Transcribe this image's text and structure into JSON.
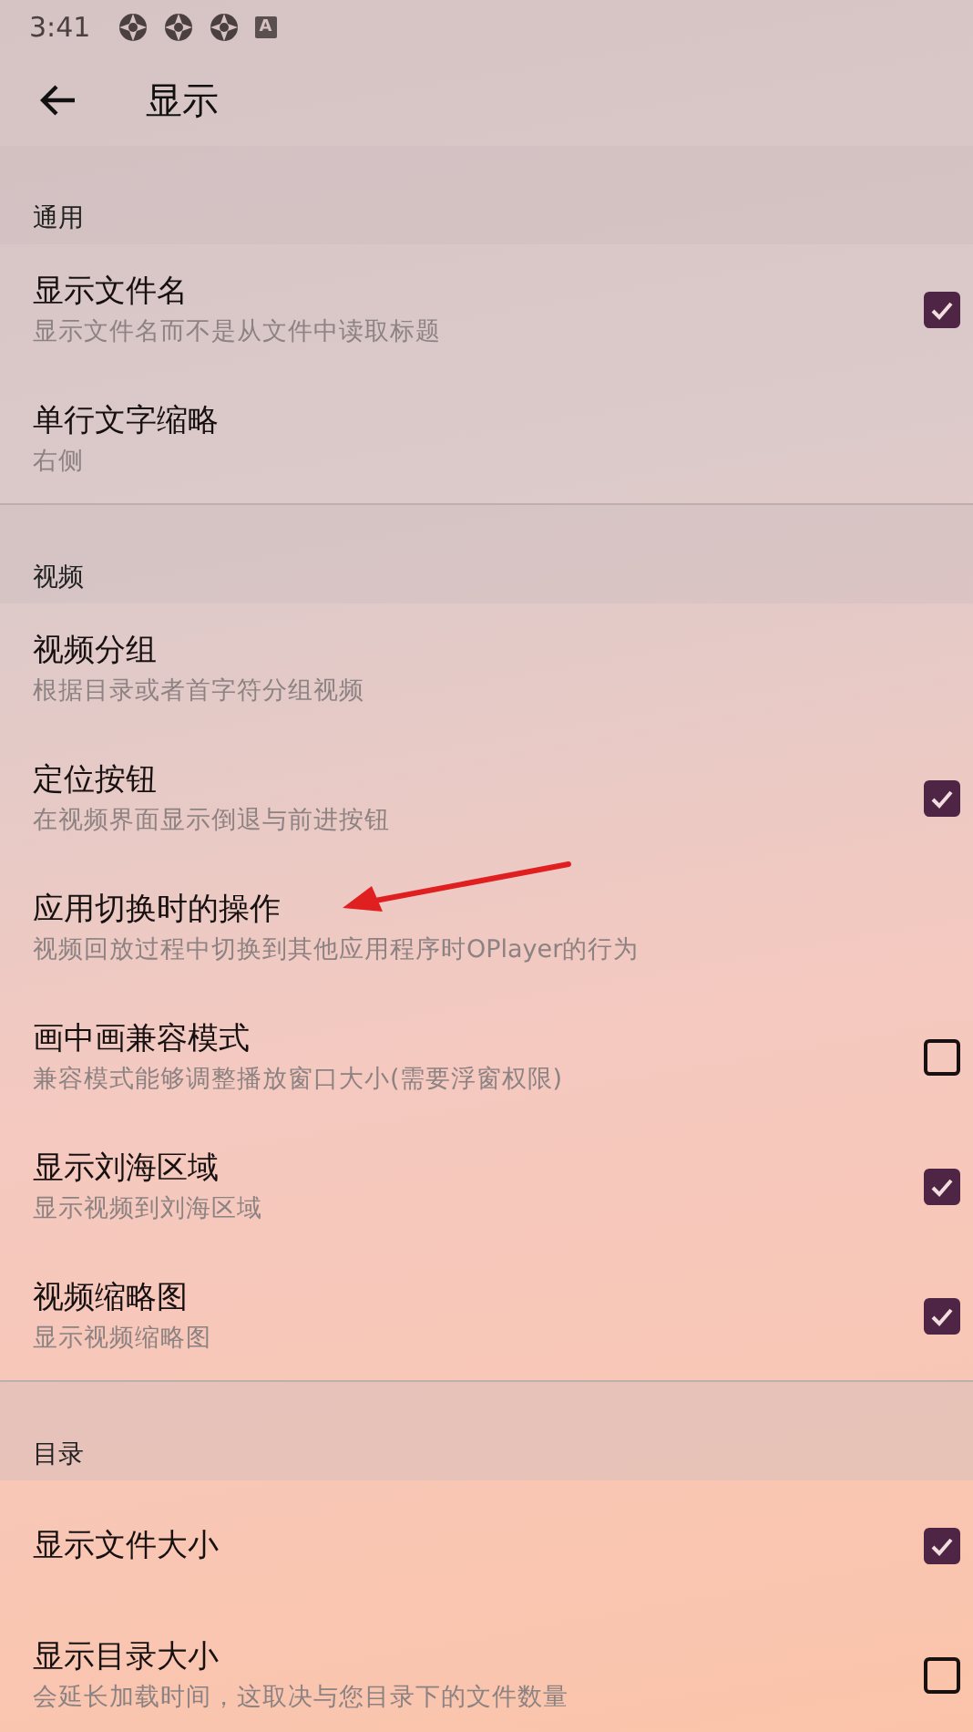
{
  "status_bar": {
    "time": "3:41",
    "badge": "A"
  },
  "app_bar": {
    "title": "显示"
  },
  "sections": [
    {
      "header": "通用",
      "items": [
        {
          "kind": "checkbox",
          "title": "显示文件名",
          "subtitle": "显示文件名而不是从文件中读取标题",
          "checked": true
        },
        {
          "kind": "plain",
          "title": "单行文字缩略",
          "subtitle": "右侧"
        }
      ]
    },
    {
      "header": "视频",
      "items": [
        {
          "kind": "plain",
          "title": "视频分组",
          "subtitle": "根据目录或者首字符分组视频"
        },
        {
          "kind": "checkbox",
          "title": "定位按钮",
          "subtitle": "在视频界面显示倒退与前进按钮",
          "checked": true
        },
        {
          "kind": "plain",
          "title": "应用切换时的操作",
          "subtitle": "视频回放过程中切换到其他应用程序时OPlayer的行为"
        },
        {
          "kind": "checkbox",
          "title": "画中画兼容模式",
          "subtitle": "兼容模式能够调整播放窗口大小(需要浮窗权限)",
          "checked": false
        },
        {
          "kind": "checkbox",
          "title": "显示刘海区域",
          "subtitle": "显示视频到刘海区域",
          "checked": true
        },
        {
          "kind": "checkbox",
          "title": "视频缩略图",
          "subtitle": "显示视频缩略图",
          "checked": true
        }
      ]
    },
    {
      "header": "目录",
      "items": [
        {
          "kind": "checkbox",
          "title": "显示文件大小",
          "checked": true
        },
        {
          "kind": "checkbox",
          "title": "显示目录大小",
          "subtitle": "会延长加载时间，这取决与您目录下的文件数量",
          "checked": false
        }
      ]
    }
  ]
}
